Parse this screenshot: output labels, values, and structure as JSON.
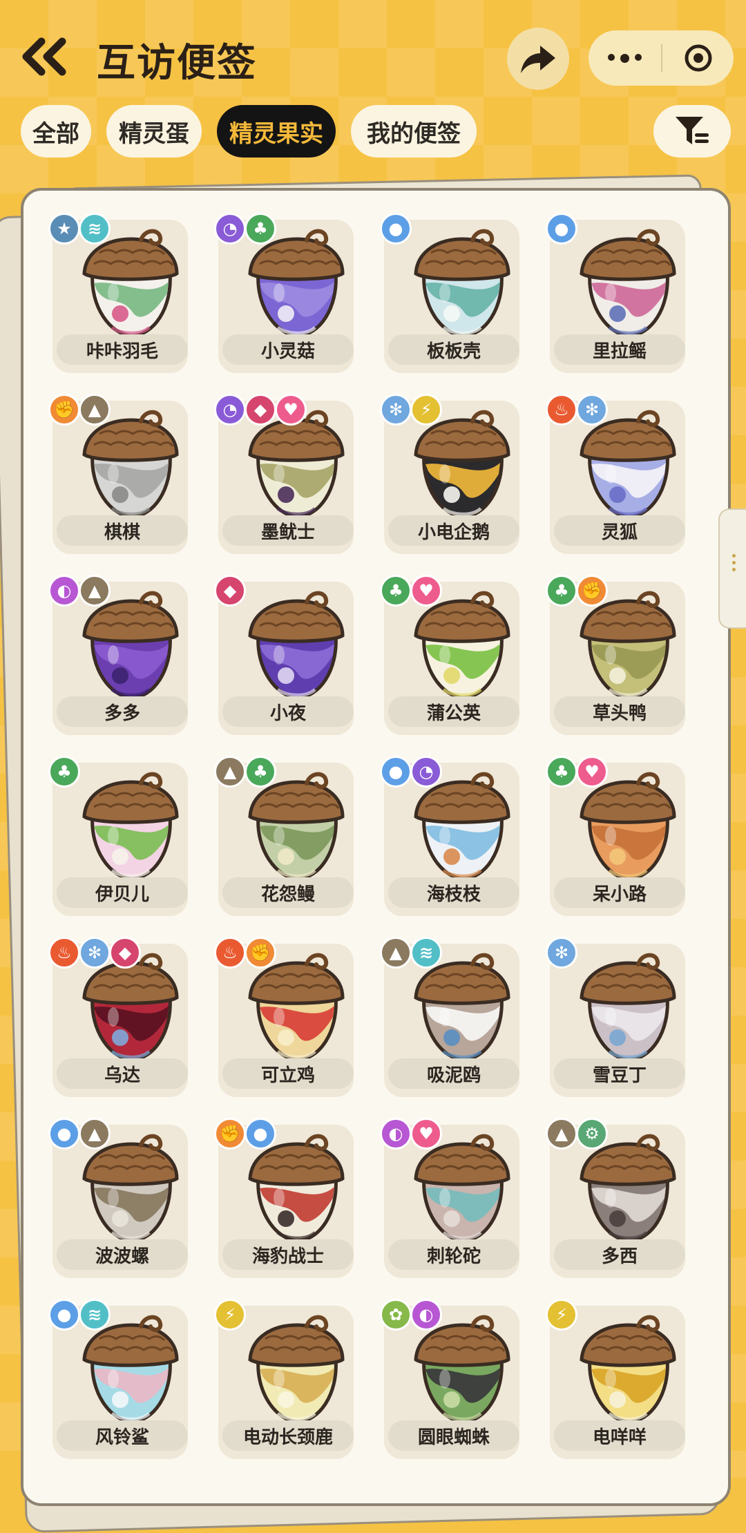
{
  "header": {
    "title": "互访便签"
  },
  "tabs": [
    {
      "label": "全部",
      "active": false
    },
    {
      "label": "精灵蛋",
      "active": false
    },
    {
      "label": "精灵果实",
      "active": true
    },
    {
      "label": "我的便签",
      "active": false
    }
  ],
  "icons": {
    "back": "double-chevron-left-icon",
    "share": "share-arrow-icon",
    "more": "more-dots-icon",
    "close": "target-circle-icon",
    "filter": "filter-funnel-icon"
  },
  "element_types": {
    "normal": {
      "color": "#5a8db6",
      "glyph": "★"
    },
    "wind": {
      "color": "#52bfc7",
      "glyph": "≋"
    },
    "ghost": {
      "color": "#8a5bd6",
      "glyph": "◔"
    },
    "grass": {
      "color": "#4aa85a",
      "glyph": "♣"
    },
    "water": {
      "color": "#5d9fe6",
      "glyph": "●"
    },
    "fighting": {
      "color": "#f08a35",
      "glyph": "✊"
    },
    "earth": {
      "color": "#8b7a5f",
      "glyph": "▲"
    },
    "demon": {
      "color": "#d6456e",
      "glyph": "◆"
    },
    "cute": {
      "color": "#ee5c8e",
      "glyph": "♥"
    },
    "ice": {
      "color": "#6fa7de",
      "glyph": "✻"
    },
    "electric": {
      "color": "#e4c033",
      "glyph": "⚡"
    },
    "fire": {
      "color": "#ea5a31",
      "glyph": "♨"
    },
    "magic": {
      "color": "#b757d3",
      "glyph": "◐"
    },
    "machine": {
      "color": "#58a774",
      "glyph": "⚙"
    },
    "bug": {
      "color": "#86b84a",
      "glyph": "✿"
    }
  },
  "items": [
    {
      "name": "咔咔羽毛",
      "types": [
        "normal",
        "wind"
      ],
      "colors": [
        "#f4f1ec",
        "#7cbb87",
        "#d75b8a"
      ]
    },
    {
      "name": "小灵菇",
      "types": [
        "ghost",
        "grass"
      ],
      "colors": [
        "#7c66d4",
        "#9c8ae0",
        "#f0ecf6"
      ]
    },
    {
      "name": "板板壳",
      "types": [
        "water"
      ],
      "colors": [
        "#cfe6ea",
        "#6cb5ac",
        "#f4f8f5"
      ]
    },
    {
      "name": "里拉鳐",
      "types": [
        "water"
      ],
      "colors": [
        "#f0ece8",
        "#cf6f9c",
        "#5f72b8"
      ]
    },
    {
      "name": "棋棋",
      "types": [
        "fighting",
        "earth"
      ],
      "colors": [
        "#d6d6d4",
        "#a9a9a7",
        "#8a8a88"
      ]
    },
    {
      "name": "墨鱿士",
      "types": [
        "ghost",
        "demon",
        "cute"
      ],
      "colors": [
        "#efecd5",
        "#a9a86c",
        "#4a2f5a"
      ]
    },
    {
      "name": "小电企鹅",
      "types": [
        "ice",
        "electric"
      ],
      "colors": [
        "#2b2b2d",
        "#eab33a",
        "#f7f5f0"
      ]
    },
    {
      "name": "灵狐",
      "types": [
        "fire",
        "ice"
      ],
      "colors": [
        "#a7aee6",
        "#f2f0f7",
        "#6a6ec6"
      ]
    },
    {
      "name": "多多",
      "types": [
        "magic",
        "earth"
      ],
      "colors": [
        "#6b3fb0",
        "#8a5ad0",
        "#3d2270"
      ]
    },
    {
      "name": "小夜",
      "types": [
        "demon"
      ],
      "colors": [
        "#5f3fb0",
        "#8a6ad4",
        "#e0d6f2"
      ]
    },
    {
      "name": "蒲公英",
      "types": [
        "grass",
        "cute"
      ],
      "colors": [
        "#f6f2df",
        "#7fc24a",
        "#e2d86b"
      ]
    },
    {
      "name": "草头鸭",
      "types": [
        "grass",
        "fighting"
      ],
      "colors": [
        "#c4c07a",
        "#9a9a54",
        "#f3f0d9"
      ]
    },
    {
      "name": "伊贝儿",
      "types": [
        "grass"
      ],
      "colors": [
        "#f3d4e4",
        "#7fbf5a",
        "#f6f2ea"
      ]
    },
    {
      "name": "花怨鳗",
      "types": [
        "earth",
        "grass"
      ],
      "colors": [
        "#c2cfa7",
        "#7f9a5e",
        "#efe9c8"
      ]
    },
    {
      "name": "海枝枝",
      "types": [
        "water",
        "ghost"
      ],
      "colors": [
        "#eef2f6",
        "#86bfe1",
        "#d98a4e"
      ]
    },
    {
      "name": "呆小路",
      "types": [
        "grass",
        "cute"
      ],
      "colors": [
        "#e89c5e",
        "#c7733a",
        "#f3c77a"
      ]
    },
    {
      "name": "乌达",
      "types": [
        "fire",
        "ice",
        "demon"
      ],
      "colors": [
        "#b2283a",
        "#5d1222",
        "#7fa9da"
      ]
    },
    {
      "name": "可立鸡",
      "types": [
        "fire",
        "fighting"
      ],
      "colors": [
        "#efd69a",
        "#d8453a",
        "#f7edc8"
      ]
    },
    {
      "name": "吸泥鸥",
      "types": [
        "earth",
        "wind"
      ],
      "colors": [
        "#b8a69a",
        "#f6f4f2",
        "#5a8fc2"
      ]
    },
    {
      "name": "雪豆丁",
      "types": [
        "ice"
      ],
      "colors": [
        "#cbc0c6",
        "#e9e6ea",
        "#7aa7d2"
      ]
    },
    {
      "name": "波波螺",
      "types": [
        "water",
        "earth"
      ],
      "colors": [
        "#cfc9bf",
        "#8a7b62",
        "#e9e4da"
      ]
    },
    {
      "name": "海豹战士",
      "types": [
        "fighting",
        "water"
      ],
      "colors": [
        "#f0eadb",
        "#c3443a",
        "#3a2e2a"
      ]
    },
    {
      "name": "刺轮砣",
      "types": [
        "magic",
        "cute"
      ],
      "colors": [
        "#c9b4ae",
        "#7abcbc",
        "#e7dcd7"
      ]
    },
    {
      "name": "多西",
      "types": [
        "earth",
        "machine"
      ],
      "colors": [
        "#8a7f7a",
        "#ddd6d0",
        "#4a403e"
      ]
    },
    {
      "name": "风铃鲨",
      "types": [
        "water",
        "wind"
      ],
      "colors": [
        "#a6dbe6",
        "#e7b9c6",
        "#f3f7f8"
      ]
    },
    {
      "name": "电动长颈鹿",
      "types": [
        "electric"
      ],
      "colors": [
        "#f1eab4",
        "#d8b25a",
        "#f8f6df"
      ]
    },
    {
      "name": "圆眼蜘蛛",
      "types": [
        "bug",
        "magic"
      ],
      "colors": [
        "#7aa860",
        "#3b3b3b",
        "#c9dba4"
      ]
    },
    {
      "name": "电咩咩",
      "types": [
        "electric"
      ],
      "colors": [
        "#f3de86",
        "#d9a72a",
        "#f7f2d8"
      ]
    }
  ]
}
